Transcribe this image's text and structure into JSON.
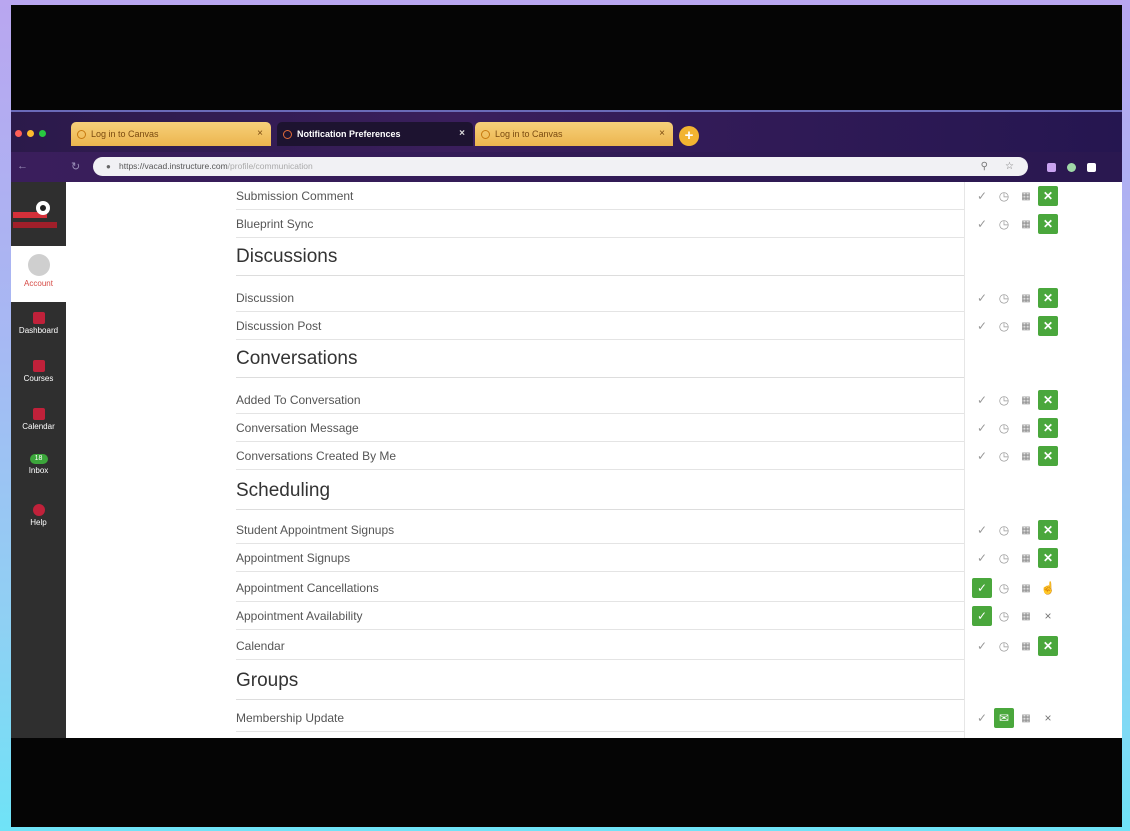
{
  "browser": {
    "tabs": [
      {
        "label": "Log in to Canvas"
      },
      {
        "label": "Notification Preferences"
      },
      {
        "label": "Log in to Canvas"
      }
    ],
    "url": "https://vacad.instructure.com",
    "url_path": "/profile/communication"
  },
  "global_nav": {
    "items": [
      {
        "label": "Account"
      },
      {
        "label": "Dashboard"
      },
      {
        "label": "Courses"
      },
      {
        "label": "Calendar"
      },
      {
        "label": "Inbox",
        "badge": "18"
      },
      {
        "label": "Help"
      }
    ]
  },
  "sections": {
    "top_rows": [
      {
        "label": "Submission Comment",
        "prefs": [
          "check",
          "clock",
          "calendar",
          "off"
        ]
      },
      {
        "label": "Blueprint Sync",
        "prefs": [
          "check",
          "clock",
          "calendar",
          "off"
        ]
      }
    ],
    "discussions": {
      "title": "Discussions",
      "rows": [
        {
          "label": "Discussion",
          "prefs": [
            "check",
            "clock",
            "calendar",
            "off"
          ]
        },
        {
          "label": "Discussion Post",
          "prefs": [
            "check",
            "clock",
            "calendar",
            "off"
          ]
        }
      ]
    },
    "conversations": {
      "title": "Conversations",
      "rows": [
        {
          "label": "Added To Conversation",
          "prefs": [
            "check",
            "clock",
            "calendar",
            "off"
          ]
        },
        {
          "label": "Conversation Message",
          "prefs": [
            "check",
            "clock",
            "calendar",
            "off"
          ]
        },
        {
          "label": "Conversations Created By Me",
          "prefs": [
            "check",
            "clock",
            "calendar",
            "off"
          ]
        }
      ]
    },
    "scheduling": {
      "title": "Scheduling",
      "rows": [
        {
          "label": "Student Appointment Signups",
          "prefs": [
            "check",
            "clock",
            "calendar",
            "off"
          ]
        },
        {
          "label": "Appointment Signups",
          "prefs": [
            "check",
            "clock",
            "calendar",
            "off"
          ]
        },
        {
          "label": "Appointment Cancellations",
          "prefs": [
            "on",
            "clock",
            "calendar",
            "cursor"
          ]
        },
        {
          "label": "Appointment Availability",
          "prefs": [
            "on",
            "clock",
            "calendar",
            "x"
          ]
        },
        {
          "label": "Calendar",
          "prefs": [
            "check",
            "clock",
            "calendar",
            "off"
          ]
        }
      ]
    },
    "groups": {
      "title": "Groups",
      "rows": [
        {
          "label": "Membership Update",
          "prefs": [
            "check",
            "clock-on",
            "calendar",
            "x"
          ]
        }
      ]
    }
  },
  "colors": {
    "accent_green": "#4aa73c",
    "canvas_red": "#c0213a",
    "nav_bg": "#2f2f2f"
  }
}
